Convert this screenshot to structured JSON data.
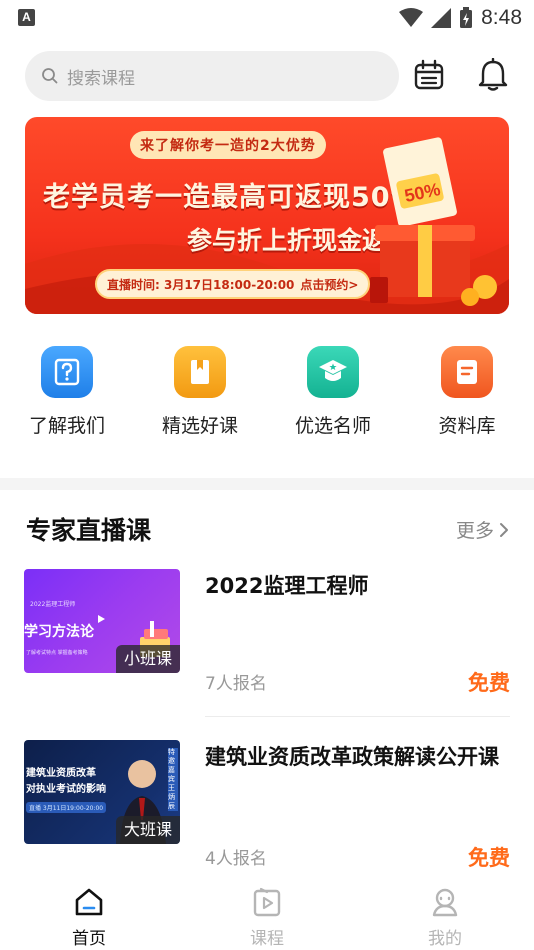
{
  "status_bar": {
    "left_badge": "A",
    "time": "8:48"
  },
  "search": {
    "placeholder": "搜索课程"
  },
  "icons": {
    "calendar": "calendar-icon",
    "bell": "bell-icon",
    "search": "search-icon"
  },
  "banner": {
    "top_line": "来了解你考一造的2大优势",
    "line1": "老学员考一造最高可返现50%!",
    "line2": "参与折上折现金返现",
    "time_text": "直播时间: 3月17日18:00-20:00",
    "cta": "点击预约>",
    "art_badge": "50%"
  },
  "quick_nav": [
    {
      "label": "了解我们",
      "icon": "question-doc-icon",
      "color": "#2a8cf0"
    },
    {
      "label": "精选好课",
      "icon": "book-icon",
      "color": "#f5a21b"
    },
    {
      "label": "优选名师",
      "icon": "teacher-star-icon",
      "color": "#1ec3a4"
    },
    {
      "label": "资料库",
      "icon": "document-icon",
      "color": "#f5662c"
    }
  ],
  "section": {
    "title": "专家直播课",
    "more": "更多"
  },
  "courses": [
    {
      "title": "2022监理工程师",
      "enroll": "7人报名",
      "price": "免费",
      "badge": "小班课",
      "thumb_small": "2022监理工程师",
      "thumb_title": "学习方法论",
      "thumb_sub": "了解考试特点 掌握备考策略"
    },
    {
      "title": "建筑业资质改革政策解读公开课",
      "enroll": "4人报名",
      "price": "免费",
      "badge": "大班课",
      "thumb_title": "建筑业资质改革\n对执业考试的影响",
      "thumb_sub": "直播 3月11日19:00-20:00",
      "thumb_name": "特邀嘉宾 王炳辰"
    }
  ],
  "bottom_nav": [
    {
      "label": "首页",
      "icon": "home-icon",
      "active": true
    },
    {
      "label": "课程",
      "icon": "course-play-icon",
      "active": false
    },
    {
      "label": "我的",
      "icon": "profile-icon",
      "active": false
    }
  ],
  "colors": {
    "accent": "#ff6a1a",
    "active_tab": "#111111",
    "inactive_tab": "#b5b5b5"
  }
}
